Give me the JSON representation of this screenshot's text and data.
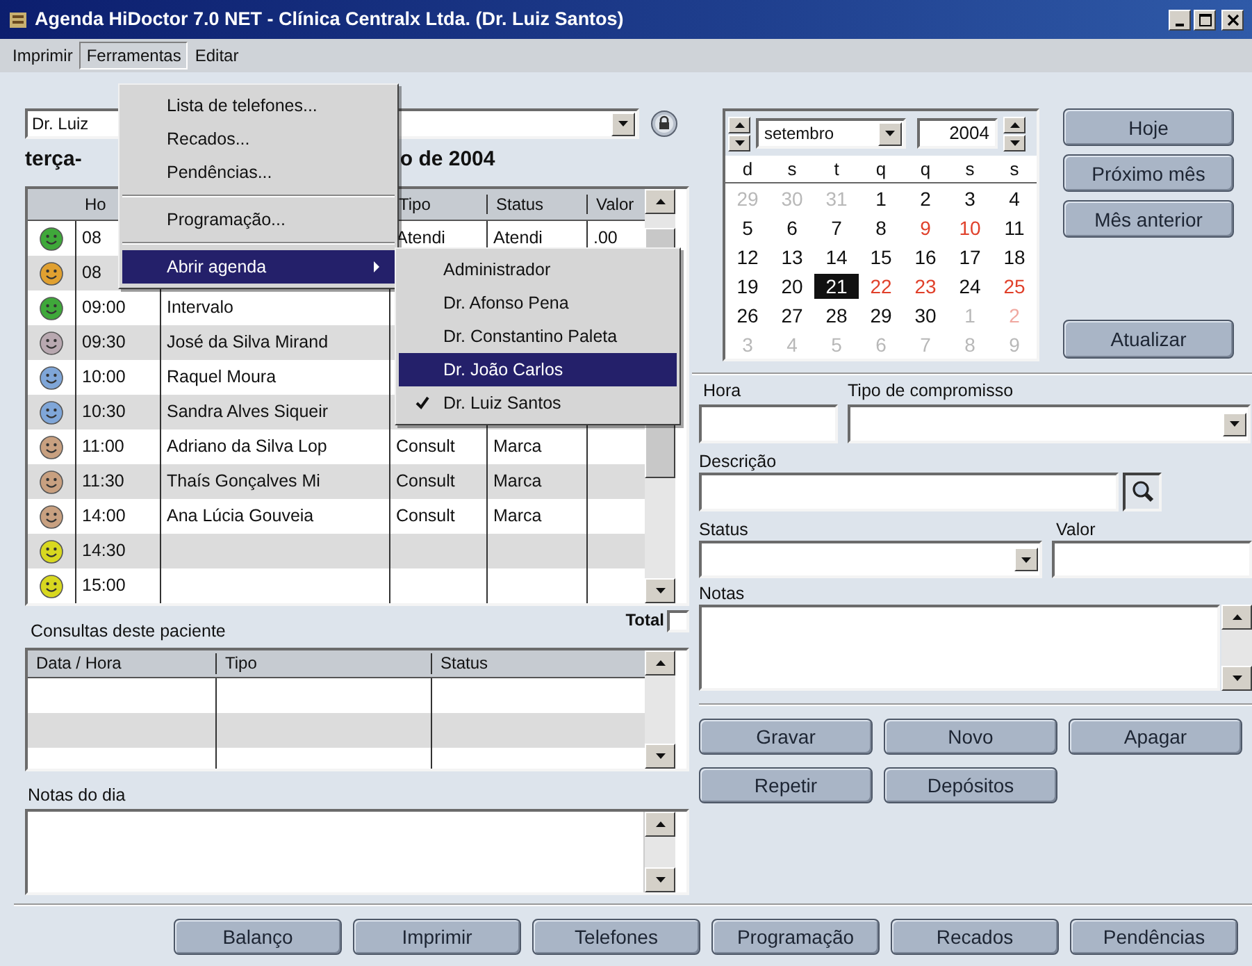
{
  "window": {
    "title": "Agenda HiDoctor 7.0 NET - Clínica Centralx Ltda. (Dr. Luiz Santos)"
  },
  "menu_bar": [
    {
      "label": "Imprimir",
      "open": false
    },
    {
      "label": "Ferramentas",
      "open": true
    },
    {
      "label": "Editar",
      "open": false
    }
  ],
  "tools_menu": [
    {
      "kind": "item",
      "label": "Lista de telefones...",
      "highlighted": false
    },
    {
      "kind": "item",
      "label": "Recados...",
      "highlighted": false
    },
    {
      "kind": "item",
      "label": "Pendências...",
      "highlighted": false
    },
    {
      "kind": "separator"
    },
    {
      "kind": "item",
      "label": "Programação...",
      "highlighted": false
    },
    {
      "kind": "separator"
    },
    {
      "kind": "submenu",
      "label": "Abrir agenda",
      "highlighted": true
    }
  ],
  "agenda_submenu": [
    {
      "label": "Administrador",
      "highlighted": false,
      "checked": false
    },
    {
      "label": "Dr. Afonso Pena",
      "highlighted": false,
      "checked": false
    },
    {
      "label": "Dr. Constantino Paleta",
      "highlighted": false,
      "checked": false
    },
    {
      "label": "Dr. João Carlos",
      "highlighted": true,
      "checked": false
    },
    {
      "label": "Dr. Luiz Santos",
      "highlighted": false,
      "checked": true
    }
  ],
  "doctor_select": {
    "value": "Dr. Luiz"
  },
  "date_heading": {
    "left": "terça-",
    "right": "o de 2004"
  },
  "schedule": {
    "columns": {
      "time": "Ho",
      "tipo": "Tipo",
      "status": "Status",
      "valor": "Valor"
    },
    "rows": [
      {
        "color": "#3fa83a",
        "time": "08",
        "tipo": "Atendi",
        "status": "Atendi",
        "valor": ".00"
      },
      {
        "color": "#e0a030",
        "time": "08"
      },
      {
        "color": "#3fa83a",
        "time": "09:00",
        "name": "Intervalo"
      },
      {
        "color": "#b8a8b0",
        "time": "09:30",
        "name": "José da Silva Mirand"
      },
      {
        "color": "#7fa6d8",
        "time": "10:00",
        "name": "Raquel Moura"
      },
      {
        "color": "#7fa6d8",
        "time": "10:30",
        "name": "Sandra Alves Siqueir"
      },
      {
        "color": "#c8a080",
        "time": "11:00",
        "name": "Adriano da Silva Lop",
        "tipo": "Consult",
        "status": "Marca"
      },
      {
        "color": "#c8a080",
        "time": "11:30",
        "name": "Thaís Gonçalves Mi",
        "tipo": "Consult",
        "status": "Marca"
      },
      {
        "color": "#c8a080",
        "time": "14:00",
        "name": "Ana Lúcia Gouveia",
        "tipo": "Consult",
        "status": "Marca"
      },
      {
        "color": "#d8d820",
        "time": "14:30"
      },
      {
        "color": "#d8d820",
        "time": "15:00"
      }
    ]
  },
  "total": {
    "label": "Total",
    "checked": false
  },
  "patient_consults": {
    "title": "Consultas deste paciente",
    "columns": [
      "Data / Hora",
      "Tipo",
      "Status"
    ]
  },
  "day_notes": {
    "label": "Notas do dia"
  },
  "calendar": {
    "month": "setembro",
    "year": "2004",
    "weekdays": [
      "d",
      "s",
      "t",
      "q",
      "q",
      "s",
      "s"
    ],
    "weeks": [
      [
        {
          "d": "29",
          "outside": true,
          "red": false,
          "selected": false
        },
        {
          "d": "30",
          "outside": true,
          "red": false,
          "selected": false
        },
        {
          "d": "31",
          "outside": true,
          "red": false,
          "selected": false
        },
        {
          "d": "1",
          "outside": false,
          "red": false,
          "selected": false
        },
        {
          "d": "2",
          "outside": false,
          "red": false,
          "selected": false
        },
        {
          "d": "3",
          "outside": false,
          "red": false,
          "selected": false
        },
        {
          "d": "4",
          "outside": false,
          "red": false,
          "selected": false
        }
      ],
      [
        {
          "d": "5",
          "outside": false,
          "red": false,
          "selected": false
        },
        {
          "d": "6",
          "outside": false,
          "red": false,
          "selected": false
        },
        {
          "d": "7",
          "outside": false,
          "red": false,
          "selected": false
        },
        {
          "d": "8",
          "outside": false,
          "red": false,
          "selected": false
        },
        {
          "d": "9",
          "outside": false,
          "red": true,
          "selected": false
        },
        {
          "d": "10",
          "outside": false,
          "red": true,
          "selected": false
        },
        {
          "d": "11",
          "outside": false,
          "red": false,
          "selected": false
        }
      ],
      [
        {
          "d": "12",
          "outside": false,
          "red": false,
          "selected": false
        },
        {
          "d": "13",
          "outside": false,
          "red": false,
          "selected": false
        },
        {
          "d": "14",
          "outside": false,
          "red": false,
          "selected": false
        },
        {
          "d": "15",
          "outside": false,
          "red": false,
          "selected": false
        },
        {
          "d": "16",
          "outside": false,
          "red": false,
          "selected": false
        },
        {
          "d": "17",
          "outside": false,
          "red": false,
          "selected": false
        },
        {
          "d": "18",
          "outside": false,
          "red": false,
          "selected": false
        }
      ],
      [
        {
          "d": "19",
          "outside": false,
          "red": false,
          "selected": false
        },
        {
          "d": "20",
          "outside": false,
          "red": false,
          "selected": false
        },
        {
          "d": "21",
          "outside": false,
          "red": false,
          "selected": true
        },
        {
          "d": "22",
          "outside": false,
          "red": true,
          "selected": false
        },
        {
          "d": "23",
          "outside": false,
          "red": true,
          "selected": false
        },
        {
          "d": "24",
          "outside": false,
          "red": false,
          "selected": false
        },
        {
          "d": "25",
          "outside": false,
          "red": true,
          "selected": false
        }
      ],
      [
        {
          "d": "26",
          "outside": false,
          "red": false,
          "selected": false
        },
        {
          "d": "27",
          "outside": false,
          "red": false,
          "selected": false
        },
        {
          "d": "28",
          "outside": false,
          "red": false,
          "selected": false
        },
        {
          "d": "29",
          "outside": false,
          "red": false,
          "selected": false
        },
        {
          "d": "30",
          "outside": false,
          "red": false,
          "selected": false
        },
        {
          "d": "1",
          "outside": true,
          "red": false,
          "selected": false
        },
        {
          "d": "2",
          "outside": true,
          "red": true,
          "selected": false
        }
      ],
      [
        {
          "d": "3",
          "outside": true,
          "red": false,
          "selected": false
        },
        {
          "d": "4",
          "outside": true,
          "red": false,
          "selected": false
        },
        {
          "d": "5",
          "outside": true,
          "red": false,
          "selected": false
        },
        {
          "d": "6",
          "outside": true,
          "red": false,
          "selected": false
        },
        {
          "d": "7",
          "outside": true,
          "red": false,
          "selected": false
        },
        {
          "d": "8",
          "outside": true,
          "red": false,
          "selected": false
        },
        {
          "d": "9",
          "outside": true,
          "red": false,
          "selected": false
        }
      ]
    ]
  },
  "calendar_buttons": [
    "Hoje",
    "Próximo mês",
    "Mês anterior"
  ],
  "refresh_button": "Atualizar",
  "form": {
    "hora_label": "Hora",
    "tipo_label": "Tipo de compromisso",
    "descricao_label": "Descrição",
    "status_label": "Status",
    "valor_label": "Valor",
    "notas_label": "Notas"
  },
  "form_buttons": [
    [
      "Gravar",
      "Novo",
      "Apagar"
    ],
    [
      "Repetir",
      "Depósitos"
    ]
  ],
  "bottom_buttons": [
    "Balanço",
    "Imprimir",
    "Telefones",
    "Programação",
    "Recados",
    "Pendências"
  ]
}
